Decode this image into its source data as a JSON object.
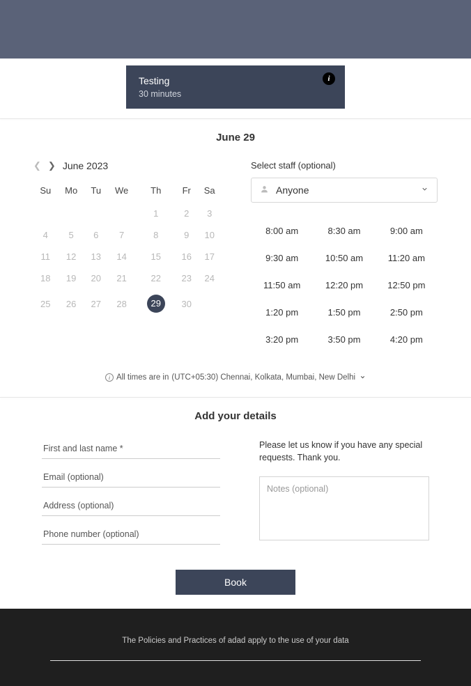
{
  "service": {
    "title": "Testing",
    "duration": "30 minutes"
  },
  "selected_date_label": "June 29",
  "calendar": {
    "month_label": "June 2023",
    "dow": [
      "Su",
      "Mo",
      "Tu",
      "We",
      "Th",
      "Fr",
      "Sa"
    ],
    "weeks": [
      [
        "",
        "",
        "",
        "",
        "1",
        "2",
        "3"
      ],
      [
        "4",
        "5",
        "6",
        "7",
        "8",
        "9",
        "10"
      ],
      [
        "11",
        "12",
        "13",
        "14",
        "15",
        "16",
        "17"
      ],
      [
        "18",
        "19",
        "20",
        "21",
        "22",
        "23",
        "24"
      ],
      [
        "25",
        "26",
        "27",
        "28",
        "29",
        "30",
        ""
      ]
    ],
    "selected_day": "29",
    "available_days": [
      "29",
      "30"
    ]
  },
  "staff": {
    "label": "Select staff (optional)",
    "selected": "Anyone"
  },
  "slots": [
    "8:00 am",
    "8:30 am",
    "9:00 am",
    "9:30 am",
    "10:50 am",
    "11:20 am",
    "11:50 am",
    "12:20 pm",
    "12:50 pm",
    "1:20 pm",
    "1:50 pm",
    "2:50 pm",
    "3:20 pm",
    "3:50 pm",
    "4:20 pm"
  ],
  "timezone": {
    "prefix": "All times are in",
    "value": "(UTC+05:30) Chennai, Kolkata, Mumbai, New Delhi"
  },
  "details": {
    "header": "Add your details",
    "name_ph": "First and last name *",
    "email_ph": "Email (optional)",
    "address_ph": "Address (optional)",
    "phone_ph": "Phone number (optional)",
    "requests_note": "Please let us know if you have any special requests. Thank you.",
    "notes_ph": "Notes (optional)"
  },
  "book_label": "Book",
  "footer_text": "The Policies and Practices of adad apply to the use of your data"
}
